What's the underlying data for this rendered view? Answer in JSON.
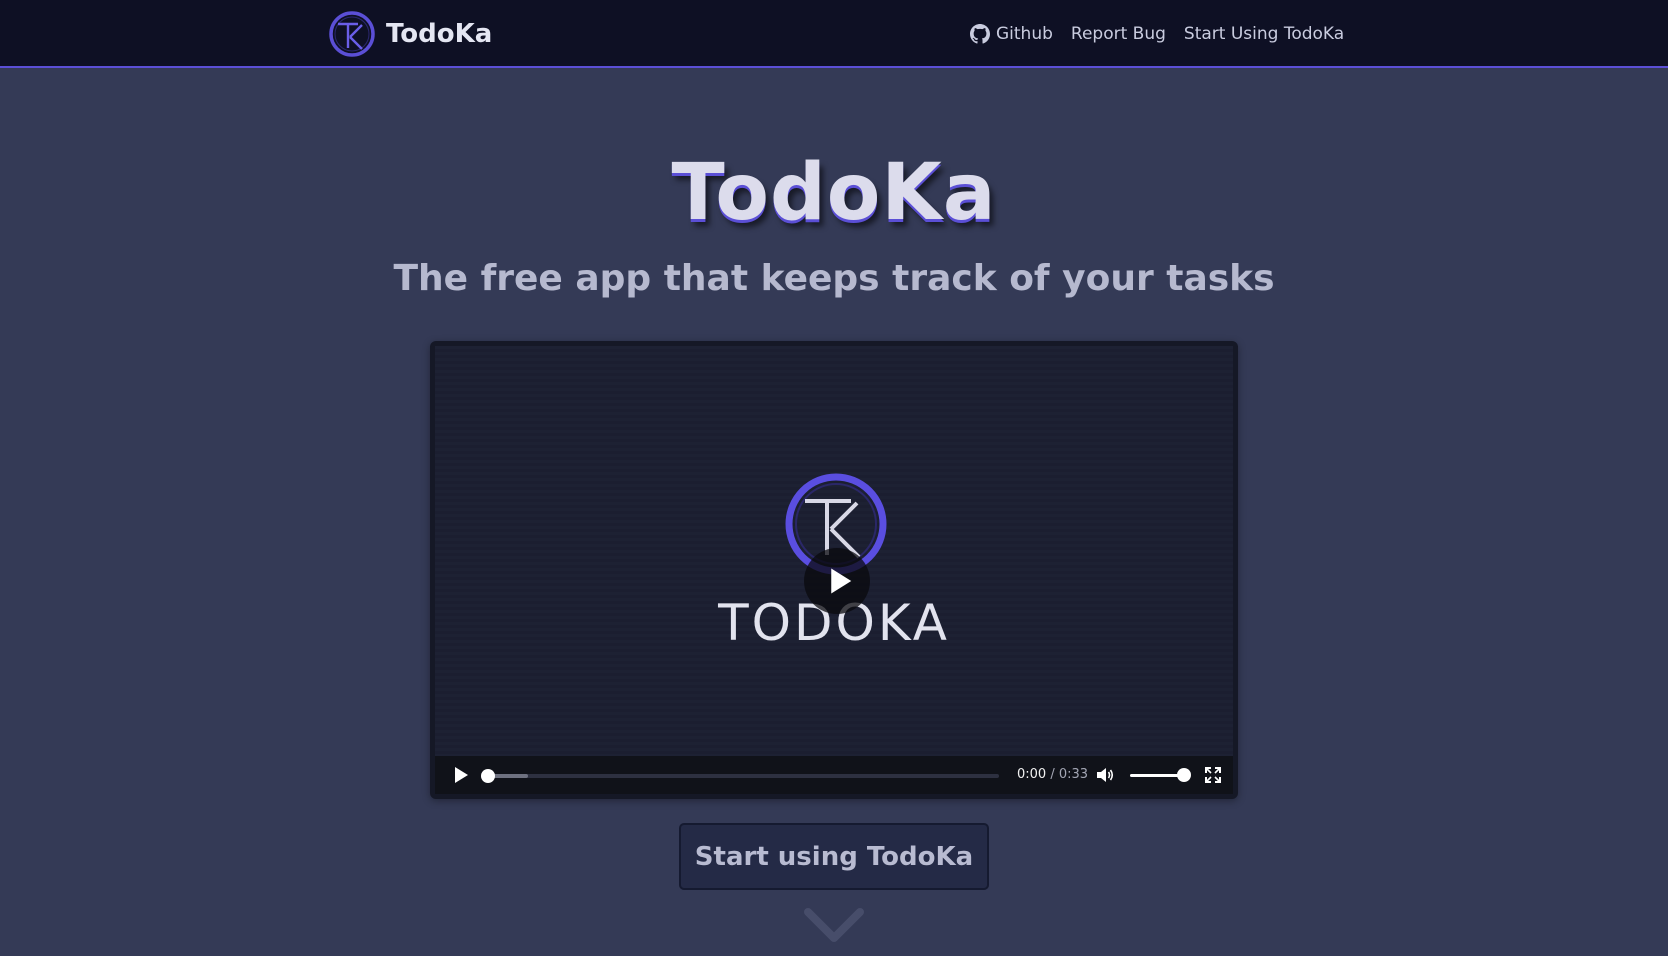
{
  "navbar": {
    "brand_name": "TodoKa",
    "links": [
      {
        "label": "Github",
        "icon": "github-icon"
      },
      {
        "label": "Report Bug"
      },
      {
        "label": "Start Using TodoKa"
      }
    ]
  },
  "hero": {
    "title": "TodoKa",
    "subtitle": "The free app that keeps track of your tasks"
  },
  "video": {
    "brand_text": "TODOKA",
    "current_time": "0:00",
    "separator": "/",
    "duration": "0:33",
    "progress": 0.0,
    "volume": 1.0,
    "icons": [
      "play-icon",
      "volume-icon",
      "fullscreen-icon"
    ]
  },
  "cta": {
    "label": "Start using TodoKa"
  },
  "colors": {
    "background": "#343a56",
    "navbar": "#0e1024",
    "accent": "#5b4fd6",
    "button": "#242a46"
  }
}
